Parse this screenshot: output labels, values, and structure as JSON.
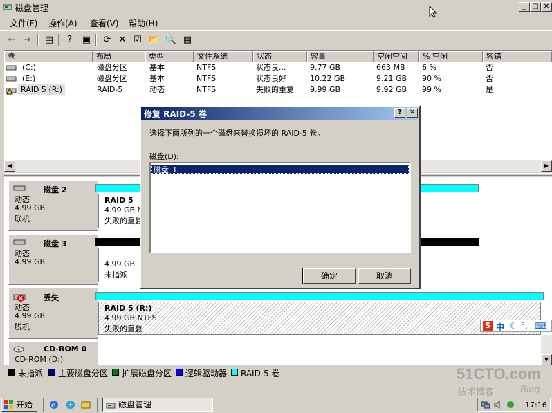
{
  "window": {
    "title": "磁盘管理",
    "min": "_",
    "max": "□",
    "close": "✕"
  },
  "menu": [
    {
      "label": "文件(F)"
    },
    {
      "label": "操作(A)"
    },
    {
      "label": "查看(V)"
    },
    {
      "label": "帮助(H)"
    }
  ],
  "toolbar": {
    "back": "←",
    "forward": "→",
    "b1": "▤",
    "b2": "?",
    "b3": "▣",
    "b4": "⟳",
    "b5": "✕",
    "b6": "☑",
    "b7": "📂",
    "b8": "🔍",
    "b9": "▦"
  },
  "volumes": {
    "columns": [
      "卷",
      "布局",
      "类型",
      "文件系统",
      "状态",
      "容量",
      "空闲空间",
      "% 空闲",
      "容错"
    ],
    "rows": [
      [
        "(C:)",
        "磁盘分区",
        "基本",
        "NTFS",
        "状态良...",
        "9.77 GB",
        "663 MB",
        "6 %",
        "否"
      ],
      [
        "(E:)",
        "磁盘分区",
        "基本",
        "NTFS",
        "状态良好",
        "10.22 GB",
        "9.21 GB",
        "90 %",
        "否"
      ],
      [
        "RAID 5 (R:)",
        "RAID-5",
        "动态",
        "NTFS",
        "失败的重复",
        "9.99 GB",
        "9.92 GB",
        "99 %",
        "是"
      ]
    ]
  },
  "disks": [
    {
      "name": "磁盘 2",
      "type": "动态",
      "size": "4.99 GB",
      "status": "联机",
      "part_title": "RAID 5",
      "part_size": "4.99 GB NTFS",
      "part_status": "失败的重复",
      "bar_color": "#00ffff"
    },
    {
      "name": "磁盘 3",
      "type": "动态",
      "size": "4.99 GB",
      "status": "未指派",
      "part_title": "",
      "part_size": "4.99 GB",
      "part_status": "未指派",
      "bar_color": "#000000"
    },
    {
      "name": "丢失",
      "type": "动态",
      "size": "4.99 GB",
      "status": "脱机",
      "part_title": "RAID 5  (R:)",
      "part_size": "4.99 GB NTFS",
      "part_status": "失败的重复",
      "bar_color": "#00ffff"
    },
    {
      "name": "CD-ROM 0",
      "type": "CD-ROM (D:)"
    }
  ],
  "disk2_label_short": "4.99 GB N",
  "disk2_status_short": "失败的重复",
  "legend": [
    {
      "label": "未指派",
      "color": "#000000"
    },
    {
      "label": "主要磁盘分区",
      "color": "#000080"
    },
    {
      "label": "扩展磁盘分区",
      "color": "#008000"
    },
    {
      "label": "逻辑驱动器",
      "color": "#0000ff"
    },
    {
      "label": "RAID-5 卷",
      "color": "#00ffff"
    }
  ],
  "dialog": {
    "title": "修复 RAID-5 卷",
    "help": "?",
    "close": "✕",
    "instruction": "选择下面所列的一个磁盘来替换损坏的 RAID-5 卷。",
    "list_label": "磁盘(D):",
    "list_items": [
      "磁盘 3"
    ],
    "ok": "确定",
    "cancel": "取消"
  },
  "taskbar": {
    "start": "开始",
    "task": "磁盘管理",
    "clock": "17:16"
  },
  "watermark": {
    "main": "51CTO.com",
    "sub": "技术博客",
    "blog": "Blog"
  }
}
